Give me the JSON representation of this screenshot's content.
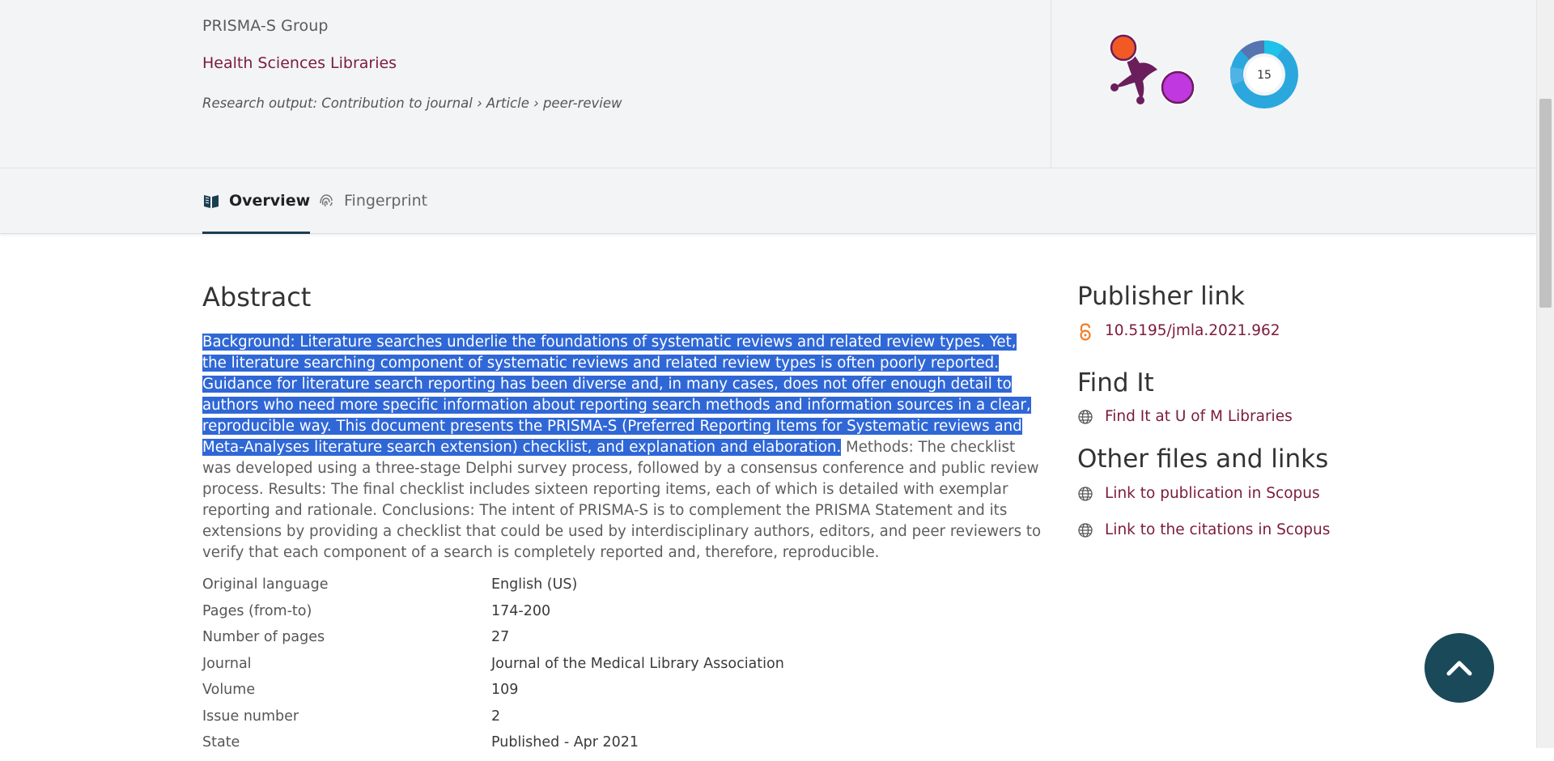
{
  "header": {
    "group_name": "PRISMA-S Group",
    "organisation_link": "Health Sciences Libraries",
    "research_output_label": "Research output:",
    "research_output_type": "Contribution to journal › Article › peer-review"
  },
  "metrics": {
    "altmetric_score": "15"
  },
  "tabs": [
    {
      "label": "Overview",
      "active": true
    },
    {
      "label": "Fingerprint",
      "active": false
    }
  ],
  "abstract": {
    "heading": "Abstract",
    "selected_text": "Background: Literature searches underlie the foundations of systematic reviews and related review types. Yet, the literature searching component of systematic reviews and related review types is often poorly reported. Guidance for literature search reporting has been diverse and, in many cases, does not offer enough detail to authors who need more specific information about reporting search methods and information sources in a clear, reproducible way. This document presents the PRISMA-S (Preferred Reporting Items for Systematic reviews and Meta-Analyses literature search extension) checklist, and explanation and elaboration.",
    "rest_text": " Methods: The checklist was developed using a three-stage Delphi survey process, followed by a consensus conference and public review process. Results: The final checklist includes sixteen reporting items, each of which is detailed with exemplar reporting and rationale. Conclusions: The intent of PRISMA-S is to complement the PRISMA Statement and its extensions by providing a checklist that could be used by interdisciplinary authors, editors, and peer reviewers to verify that each component of a search is completely reported and, therefore, reproducible."
  },
  "details": [
    {
      "label": "Original language",
      "value": "English (US)"
    },
    {
      "label": "Pages (from-to)",
      "value": "174-200"
    },
    {
      "label": "Number of pages",
      "value": "27"
    },
    {
      "label": "Journal",
      "value": "Journal of the Medical Library Association"
    },
    {
      "label": "Volume",
      "value": "109"
    },
    {
      "label": "Issue number",
      "value": "2"
    },
    {
      "label": "State",
      "value": "Published - Apr 2021"
    }
  ],
  "sidebar": {
    "publisher_heading": "Publisher link",
    "publisher_link": "10.5195/jmla.2021.962",
    "find_it_heading": "Find It",
    "find_it_link": "Find It at U of M Libraries",
    "other_heading": "Other files and links",
    "other_links": [
      "Link to publication in Scopus",
      "Link to the citations in Scopus"
    ]
  },
  "colors": {
    "link": "#7b1c3a",
    "selection": "#2f67d6",
    "back_to_top": "#1a4a5a",
    "header_bg": "#f3f4f6"
  },
  "icons": {
    "overview_tab": "book-icon",
    "fingerprint_tab": "fingerprint-icon",
    "publisher_link": "open-access-icon",
    "find_it": "globe-icon",
    "other_links": "globe-icon",
    "back_to_top": "chevron-up-icon"
  }
}
